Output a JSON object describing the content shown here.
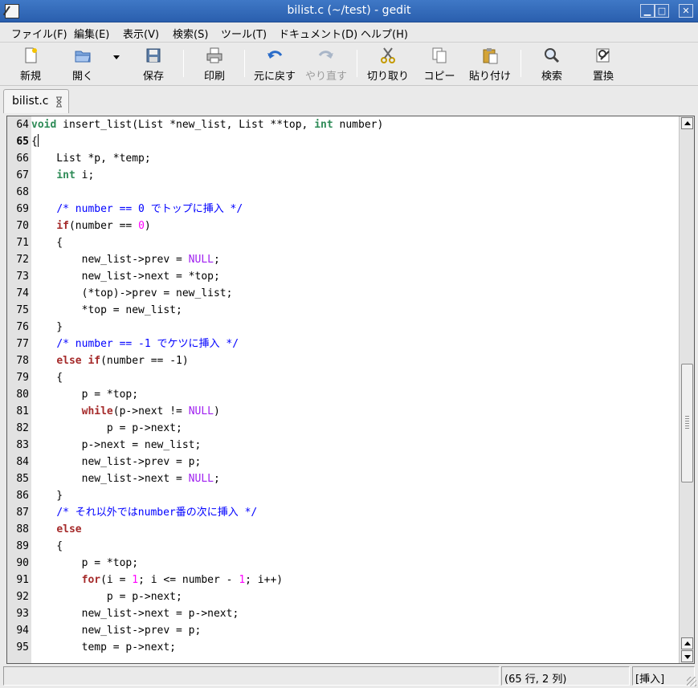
{
  "window": {
    "title": "bilist.c (~/test) - gedit",
    "controls": [
      "minimize",
      "maximize",
      "close"
    ]
  },
  "menu": [
    "ファイル(F)",
    "編集(E)",
    "表示(V)",
    "検索(S)",
    "ツール(T)",
    "ドキュメント(D)",
    "ヘルプ(H)"
  ],
  "toolbar": {
    "new_label": "新規",
    "open_label": "開く",
    "save_label": "保存",
    "print_label": "印刷",
    "undo_label": "元に戻す",
    "redo_label": "やり直す",
    "cut_label": "切り取り",
    "copy_label": "コピー",
    "paste_label": "貼り付け",
    "find_label": "検索",
    "replace_label": "置換"
  },
  "tab": {
    "label": "bilist.c"
  },
  "editor": {
    "current_line": 65,
    "lines": [
      {
        "n": "64",
        "text": "void insert_list(List *new_list, List **top, int number)"
      },
      {
        "n": "65",
        "text": "{"
      },
      {
        "n": "66",
        "text": "    List *p, *temp;"
      },
      {
        "n": "67",
        "text": "    int i;"
      },
      {
        "n": "68",
        "text": ""
      },
      {
        "n": "69",
        "text": "    /* number == 0 でトップに挿入 */"
      },
      {
        "n": "70",
        "text": "    if(number == 0)"
      },
      {
        "n": "71",
        "text": "    {"
      },
      {
        "n": "72",
        "text": "        new_list->prev = NULL;"
      },
      {
        "n": "73",
        "text": "        new_list->next = *top;"
      },
      {
        "n": "74",
        "text": "        (*top)->prev = new_list;"
      },
      {
        "n": "75",
        "text": "        *top = new_list;"
      },
      {
        "n": "76",
        "text": "    }"
      },
      {
        "n": "77",
        "text": "    /* number == -1 でケツに挿入 */"
      },
      {
        "n": "78",
        "text": "    else if(number == -1)"
      },
      {
        "n": "79",
        "text": "    {"
      },
      {
        "n": "80",
        "text": "        p = *top;"
      },
      {
        "n": "81",
        "text": "        while(p->next != NULL)"
      },
      {
        "n": "82",
        "text": "            p = p->next;"
      },
      {
        "n": "83",
        "text": "        p->next = new_list;"
      },
      {
        "n": "84",
        "text": "        new_list->prev = p;"
      },
      {
        "n": "85",
        "text": "        new_list->next = NULL;"
      },
      {
        "n": "86",
        "text": "    }"
      },
      {
        "n": "87",
        "text": "    /* それ以外ではnumber番の次に挿入 */"
      },
      {
        "n": "88",
        "text": "    else"
      },
      {
        "n": "89",
        "text": "    {"
      },
      {
        "n": "90",
        "text": "        p = *top;"
      },
      {
        "n": "91",
        "text": "        for(i = 1; i <= number - 1; i++)"
      },
      {
        "n": "92",
        "text": "            p = p->next;"
      },
      {
        "n": "93",
        "text": "        new_list->next = p->next;"
      },
      {
        "n": "94",
        "text": "        new_list->prev = p;"
      },
      {
        "n": "95",
        "text": "        temp = p->next;"
      }
    ]
  },
  "status": {
    "position": "(65 行, 2 列)",
    "mode": "[挿入]"
  },
  "colors": {
    "title_bar": "#2a5fae",
    "type_keyword": "#2e8b57",
    "keyword": "#a52a2a",
    "number": "#ff00ff",
    "constant": "#a020f0",
    "comment": "#0000ff"
  }
}
